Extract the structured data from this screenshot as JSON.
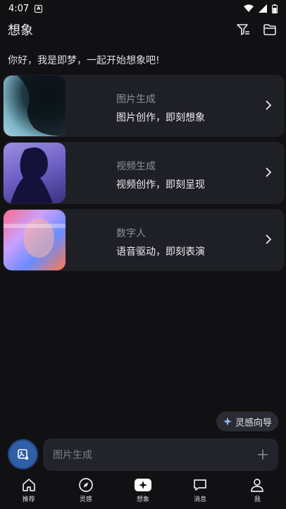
{
  "status": {
    "time": "4:07",
    "notif_icon": "a-badge-icon"
  },
  "header": {
    "title": "想象",
    "filter_icon": "filter-icon",
    "folder_icon": "folder-icon"
  },
  "greeting": "你好，我是即梦，一起开始想象吧!",
  "cards": [
    {
      "title": "图片生成",
      "subtitle": "图片创作，即刻想象"
    },
    {
      "title": "视频生成",
      "subtitle": "视频创作，即刻呈现"
    },
    {
      "title": "数字人",
      "subtitle": "语音驱动，即刻表演"
    }
  ],
  "inspire": {
    "label": "灵感向导"
  },
  "compose": {
    "placeholder": "图片生成"
  },
  "nav": [
    {
      "label": "推荐",
      "icon": "home-icon"
    },
    {
      "label": "灵感",
      "icon": "compass-icon"
    },
    {
      "label": "想象",
      "icon": "sparkle-icon"
    },
    {
      "label": "消息",
      "icon": "message-icon"
    },
    {
      "label": "我",
      "icon": "user-icon"
    }
  ],
  "colors": {
    "background": "#111114",
    "card": "#1f2026",
    "accent": "#2f5fa7"
  }
}
